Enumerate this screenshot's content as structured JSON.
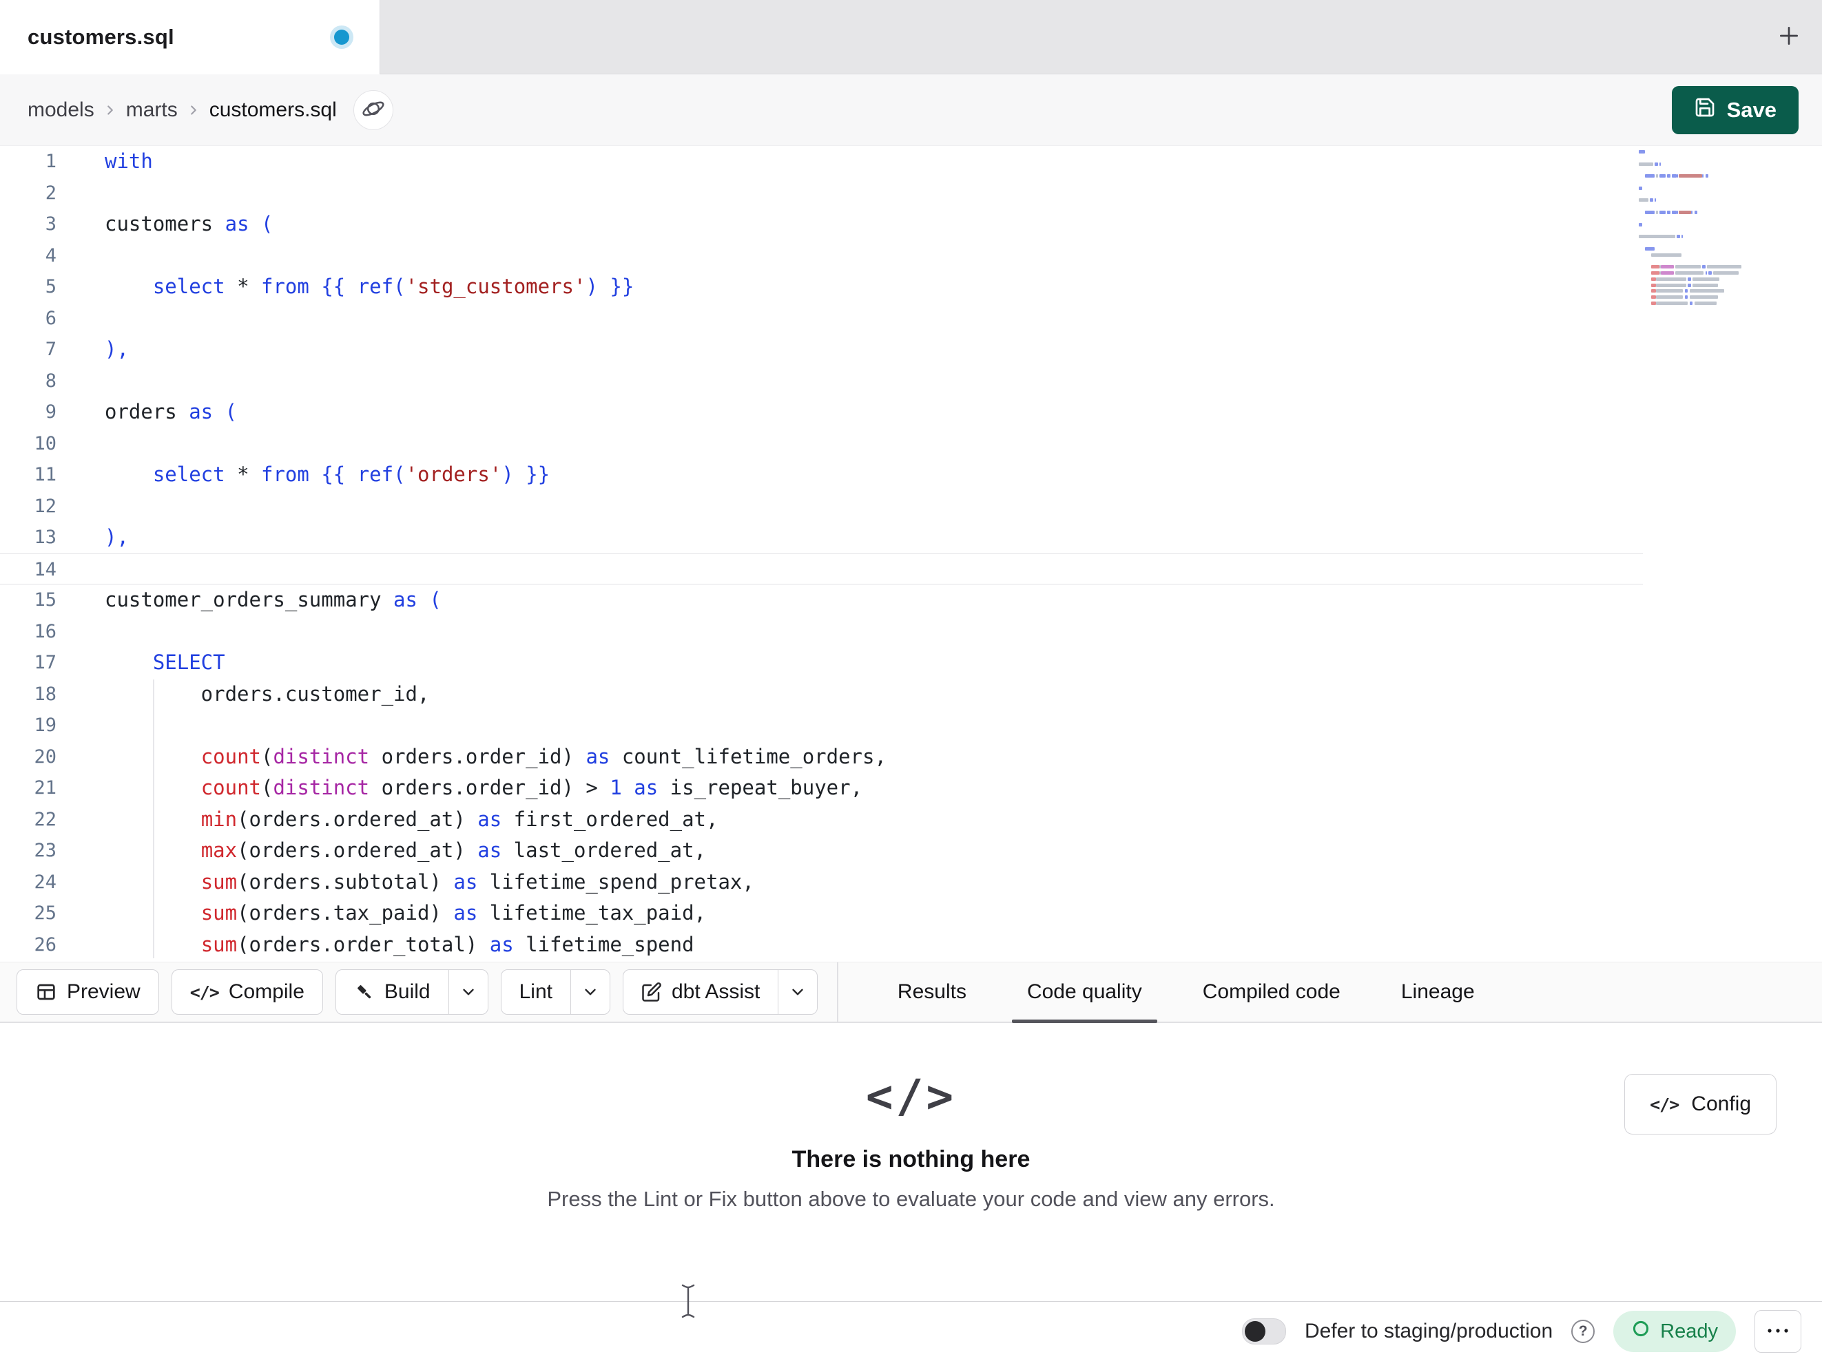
{
  "glyphs": {
    "code": "</>"
  },
  "colors": {
    "save_button": "#0a5c4b",
    "keyword": "#2240e0",
    "function": "#d0282e",
    "string": "#a32121",
    "distinct": "#a626a4",
    "number": "#2240e0",
    "unsaved_dot": "#1697cf",
    "active_tab_underline": "#55555c",
    "ready_badge_bg": "#dcf3e6",
    "ready_text": "#17804a"
  },
  "tab_bar": {
    "active_tab": "customers.sql"
  },
  "breadcrumb": {
    "items": [
      "models",
      "marts",
      "customers.sql"
    ],
    "save_label": "Save"
  },
  "editor": {
    "active_line": 14,
    "lines": [
      {
        "num": 1,
        "tokens": [
          [
            "k",
            "with"
          ]
        ]
      },
      {
        "num": 2,
        "tokens": []
      },
      {
        "num": 3,
        "tokens": [
          [
            "t",
            "customers "
          ],
          [
            "k",
            "as"
          ],
          [
            "t",
            " "
          ],
          [
            "p",
            "("
          ]
        ]
      },
      {
        "num": 4,
        "tokens": []
      },
      {
        "num": 5,
        "tokens": [
          [
            "t",
            "    "
          ],
          [
            "k",
            "select"
          ],
          [
            "t",
            " * "
          ],
          [
            "k",
            "from"
          ],
          [
            "t",
            " "
          ],
          [
            "p",
            "{{"
          ],
          [
            "t",
            " "
          ],
          [
            "k",
            "ref"
          ],
          [
            "p",
            "("
          ],
          [
            "s",
            "'stg_customers'"
          ],
          [
            "p",
            ")"
          ],
          [
            "t",
            " "
          ],
          [
            "p",
            "}}"
          ]
        ]
      },
      {
        "num": 6,
        "tokens": []
      },
      {
        "num": 7,
        "tokens": [
          [
            "p",
            "),"
          ]
        ]
      },
      {
        "num": 8,
        "tokens": []
      },
      {
        "num": 9,
        "tokens": [
          [
            "t",
            "orders "
          ],
          [
            "k",
            "as"
          ],
          [
            "t",
            " "
          ],
          [
            "p",
            "("
          ]
        ]
      },
      {
        "num": 10,
        "tokens": []
      },
      {
        "num": 11,
        "tokens": [
          [
            "t",
            "    "
          ],
          [
            "k",
            "select"
          ],
          [
            "t",
            " * "
          ],
          [
            "k",
            "from"
          ],
          [
            "t",
            " "
          ],
          [
            "p",
            "{{"
          ],
          [
            "t",
            " "
          ],
          [
            "k",
            "ref"
          ],
          [
            "p",
            "("
          ],
          [
            "s",
            "'orders'"
          ],
          [
            "p",
            ")"
          ],
          [
            "t",
            " "
          ],
          [
            "p",
            "}}"
          ]
        ]
      },
      {
        "num": 12,
        "tokens": []
      },
      {
        "num": 13,
        "tokens": [
          [
            "p",
            "),"
          ]
        ]
      },
      {
        "num": 14,
        "tokens": []
      },
      {
        "num": 15,
        "tokens": [
          [
            "t",
            "customer_orders_summary "
          ],
          [
            "k",
            "as"
          ],
          [
            "t",
            " "
          ],
          [
            "p",
            "("
          ]
        ]
      },
      {
        "num": 16,
        "tokens": []
      },
      {
        "num": 17,
        "tokens": [
          [
            "t",
            "    "
          ],
          [
            "k",
            "SELECT"
          ]
        ]
      },
      {
        "num": 18,
        "tokens": [
          [
            "t",
            "        orders.customer_id,"
          ]
        ]
      },
      {
        "num": 19,
        "tokens": []
      },
      {
        "num": 20,
        "tokens": [
          [
            "t",
            "        "
          ],
          [
            "f",
            "count"
          ],
          [
            "t",
            "("
          ],
          [
            "d",
            "distinct"
          ],
          [
            "t",
            " orders.order_id) "
          ],
          [
            "k",
            "as"
          ],
          [
            "t",
            " count_lifetime_orders,"
          ]
        ]
      },
      {
        "num": 21,
        "tokens": [
          [
            "t",
            "        "
          ],
          [
            "f",
            "count"
          ],
          [
            "t",
            "("
          ],
          [
            "d",
            "distinct"
          ],
          [
            "t",
            " orders.order_id) > "
          ],
          [
            "n",
            "1"
          ],
          [
            "t",
            " "
          ],
          [
            "k",
            "as"
          ],
          [
            "t",
            " is_repeat_buyer,"
          ]
        ]
      },
      {
        "num": 22,
        "tokens": [
          [
            "t",
            "        "
          ],
          [
            "f",
            "min"
          ],
          [
            "t",
            "(orders.ordered_at) "
          ],
          [
            "k",
            "as"
          ],
          [
            "t",
            " first_ordered_at,"
          ]
        ]
      },
      {
        "num": 23,
        "tokens": [
          [
            "t",
            "        "
          ],
          [
            "f",
            "max"
          ],
          [
            "t",
            "(orders.ordered_at) "
          ],
          [
            "k",
            "as"
          ],
          [
            "t",
            " last_ordered_at,"
          ]
        ]
      },
      {
        "num": 24,
        "tokens": [
          [
            "t",
            "        "
          ],
          [
            "f",
            "sum"
          ],
          [
            "t",
            "(orders.subtotal) "
          ],
          [
            "k",
            "as"
          ],
          [
            "t",
            " lifetime_spend_pretax,"
          ]
        ]
      },
      {
        "num": 25,
        "tokens": [
          [
            "t",
            "        "
          ],
          [
            "f",
            "sum"
          ],
          [
            "t",
            "(orders.tax_paid) "
          ],
          [
            "k",
            "as"
          ],
          [
            "t",
            " lifetime_tax_paid,"
          ]
        ]
      },
      {
        "num": 26,
        "tokens": [
          [
            "t",
            "        "
          ],
          [
            "f",
            "sum"
          ],
          [
            "t",
            "(orders.order_total) "
          ],
          [
            "k",
            "as"
          ],
          [
            "t",
            " lifetime_spend"
          ]
        ]
      }
    ]
  },
  "toolbar": {
    "buttons": [
      {
        "label": "Preview",
        "icon": "table"
      },
      {
        "label": "Compile",
        "icon": "code"
      },
      {
        "label": "Build",
        "icon": "hammer",
        "dropdown": true
      },
      {
        "label": "Lint",
        "dropdown": true
      },
      {
        "label": "dbt Assist",
        "icon": "edit",
        "dropdown": true
      }
    ],
    "tabs": [
      {
        "label": "Results"
      },
      {
        "label": "Code quality",
        "active": true
      },
      {
        "label": "Compiled code"
      },
      {
        "label": "Lineage"
      }
    ]
  },
  "results_panel": {
    "title": "There is nothing here",
    "subtitle": "Press the Lint or Fix button above to evaluate your code and view any errors.",
    "config_button": "Config"
  },
  "status_bar": {
    "defer_label": "Defer to staging/production",
    "ready_label": "Ready"
  }
}
